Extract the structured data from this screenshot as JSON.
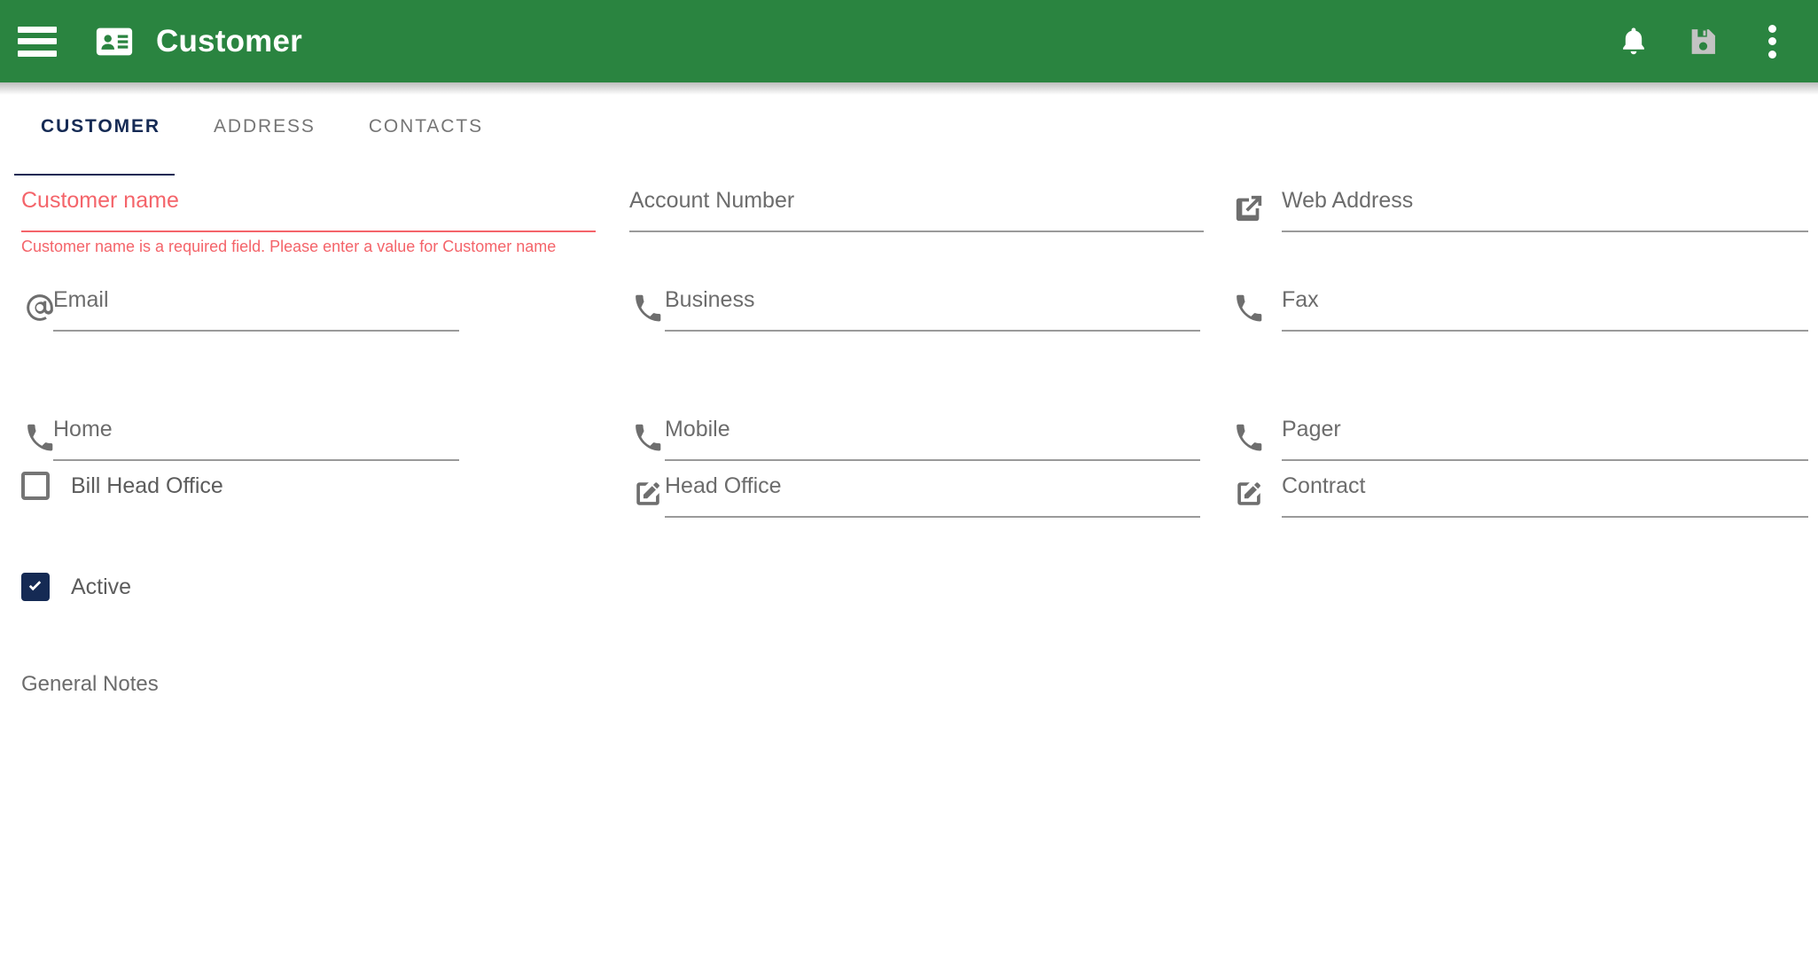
{
  "theme": {
    "appbar_green": "#2a8440",
    "accent_navy": "#152a54",
    "error_red": "#f4646a",
    "label_gray": "#6c6c6c",
    "line_gray": "#9a9a9a",
    "icon_gray": "#6e6e6e",
    "disabled_icon": "#c3c3c3"
  },
  "appbar": {
    "menu_icon": "hamburger-menu-icon",
    "app_icon": "contact-card-icon",
    "title": "Customer",
    "actions": [
      {
        "name": "notifications-bell-icon",
        "icon": "bell-icon",
        "enabled": true
      },
      {
        "name": "save-icon",
        "icon": "floppy-disk-icon",
        "enabled": false
      },
      {
        "name": "overflow-menu-icon",
        "icon": "kebab-menu-icon",
        "enabled": true
      }
    ]
  },
  "tabs": {
    "items": [
      {
        "label": "CUSTOMER",
        "active": true
      },
      {
        "label": "ADDRESS",
        "active": false
      },
      {
        "label": "CONTACTS",
        "active": false
      }
    ]
  },
  "form": {
    "fields": [
      {
        "name": "customer-name",
        "label": "Customer name",
        "value": "",
        "icon": null,
        "error": true,
        "error_text": "Customer name is a required field. Please enter a value for Customer name"
      },
      {
        "name": "account-number",
        "label": "Account Number",
        "value": "",
        "icon": null,
        "error": false,
        "error_text": ""
      },
      {
        "name": "web-address",
        "label": "Web Address",
        "value": "",
        "icon": "external-link-icon",
        "error": false,
        "error_text": ""
      },
      {
        "name": "email",
        "label": "Email",
        "value": "",
        "icon": "at-sign-icon",
        "error": false,
        "error_text": ""
      },
      {
        "name": "business-phone",
        "label": "Business",
        "value": "",
        "icon": "phone-icon",
        "error": false,
        "error_text": ""
      },
      {
        "name": "fax",
        "label": "Fax",
        "value": "",
        "icon": "phone-icon",
        "error": false,
        "error_text": ""
      },
      {
        "name": "home-phone",
        "label": "Home",
        "value": "",
        "icon": "phone-icon",
        "error": false,
        "error_text": ""
      },
      {
        "name": "mobile-phone",
        "label": "Mobile",
        "value": "",
        "icon": "phone-icon",
        "error": false,
        "error_text": ""
      },
      {
        "name": "pager",
        "label": "Pager",
        "value": "",
        "icon": "phone-icon",
        "error": false,
        "error_text": ""
      },
      {
        "name": "head-office",
        "label": "Head Office",
        "value": "",
        "icon": "edit-pencil-icon",
        "error": false,
        "error_text": ""
      },
      {
        "name": "contract",
        "label": "Contract",
        "value": "",
        "icon": "edit-pencil-icon",
        "error": false,
        "error_text": ""
      }
    ],
    "checkboxes": [
      {
        "name": "bill-head-office",
        "label": "Bill Head Office",
        "checked": false
      },
      {
        "name": "active",
        "label": "Active",
        "checked": true
      }
    ],
    "notes_label": "General Notes",
    "notes_value": ""
  }
}
